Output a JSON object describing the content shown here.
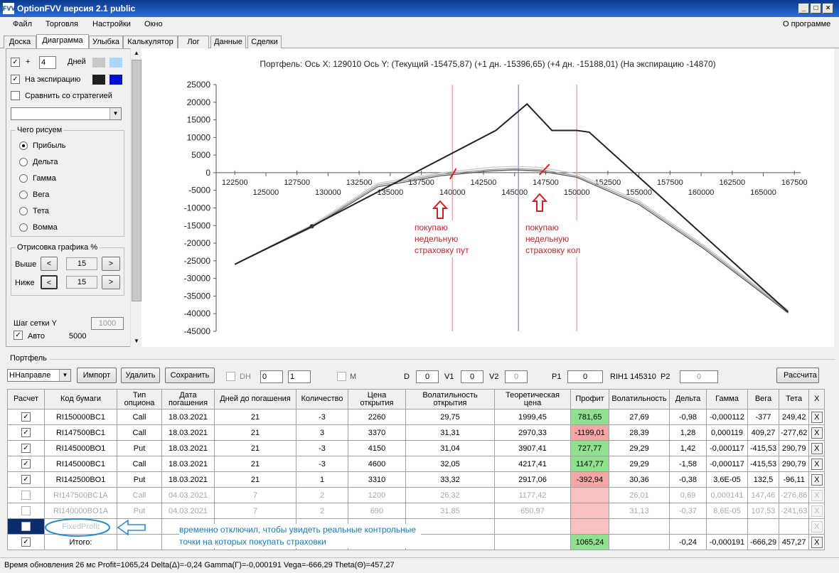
{
  "window": {
    "title": "OptionFVV версия 2.1 public",
    "icon": "FVV"
  },
  "menu": [
    "Файл",
    "Торговля",
    "Настройки",
    "Окно"
  ],
  "menu_right": "О программе",
  "tabs": [
    "Доска",
    "Диаграмма",
    "Улыбка",
    "Калькулятор",
    "Лог",
    "Данные",
    "Сделки"
  ],
  "left": {
    "plus_label": "+",
    "days_value": "4",
    "days_label": "Дней",
    "expiry_label": "На экспирацию",
    "compare_label": "Сравнить со стратегией",
    "draw_group": "Чего рисуем",
    "radios": [
      "Прибыль",
      "Дельта",
      "Гамма",
      "Вега",
      "Тета",
      "Вомма"
    ],
    "selected_radio": "Прибыль",
    "render_group": "Отрисовка графика %",
    "above_label": "Выше",
    "above_value": "15",
    "below_label": "Ниже",
    "below_value": "15",
    "grid_step_label": "Шаг сетки Y",
    "grid_step_value": "1000",
    "auto_label": "Авто",
    "auto_value": "5000",
    "btn_left": "<",
    "btn_right": ">",
    "swatch_colors": [
      "#c8c8c8",
      "#a8d8ff",
      "#202020",
      "#0010d0"
    ]
  },
  "chart_header": "Портфель: Ось X:  129010 Ось Y:   (Текущий -15475,87)   (+1 дн. -15396,65)   (+4 дн. -15188,01)   (На экспирацию -14870)",
  "chart_data": {
    "type": "line",
    "xlim": [
      121000,
      168000
    ],
    "ylim": [
      -45000,
      25000
    ],
    "y_ticks": [
      25000,
      20000,
      15000,
      10000,
      5000,
      0,
      -5000,
      -10000,
      -15000,
      -20000,
      -25000,
      -30000,
      -35000,
      -40000,
      -45000
    ],
    "x_ticks_upper": [
      122500,
      127500,
      132500,
      137500,
      142500,
      147500,
      152500,
      157500,
      162500,
      167500
    ],
    "x_ticks_lower": [
      125000,
      130000,
      135000,
      140000,
      145000,
      150000,
      155000,
      160000,
      165000
    ],
    "series": [
      {
        "color": "#222222",
        "x": [
          122500,
          128700,
          143500,
          146000,
          148000,
          150000,
          151000,
          167000
        ],
        "y": [
          -26000,
          -15200,
          12000,
          19500,
          12000,
          12000,
          11500,
          -39500
        ]
      },
      {
        "color": "#c8c8c8",
        "x": [
          122500,
          128700,
          134000,
          139000,
          143000,
          145000,
          147000,
          150000,
          155000,
          160000,
          167000
        ],
        "y": [
          -26000,
          -14800,
          -3000,
          -100,
          1500,
          1800,
          1500,
          -300,
          -8000,
          -20000,
          -39000
        ]
      },
      {
        "color": "#999999",
        "x": [
          122500,
          128700,
          134000,
          139000,
          143000,
          145000,
          147000,
          150000,
          155000,
          160000,
          167000
        ],
        "y": [
          -26000,
          -15200,
          -3500,
          -500,
          900,
          1200,
          900,
          -900,
          -8500,
          -20500,
          -39400
        ]
      },
      {
        "color": "#555555",
        "x": [
          122500,
          128700,
          134000,
          139000,
          143000,
          145000,
          147000,
          150000,
          155000,
          160000,
          167000
        ],
        "y": [
          -26000,
          -15500,
          -4000,
          -900,
          500,
          800,
          500,
          -1300,
          -9000,
          -21000,
          -39800
        ]
      }
    ],
    "vlines": [
      {
        "x": 145310,
        "color": "#8090c0"
      },
      {
        "x": 140000,
        "color": "#f0a0a0"
      },
      {
        "x": 150000,
        "color": "#f0a0a0"
      }
    ],
    "marker": {
      "x": 128700,
      "y": -15200
    }
  },
  "annotations": {
    "put": "покупаю недельную страховку пут",
    "call": "покупаю недельную страховку кол",
    "disabled": "временно отключил, чтобы увидеть реальные контрольные точки на которых покупать страховки"
  },
  "portfolio": {
    "label": "Портфель",
    "select_value": "ННаправле",
    "import_btn": "Импорт",
    "delete_btn": "Удалить",
    "save_btn": "Сохранить",
    "dh_label": "DH",
    "dh_v1": "0",
    "dh_v2": "1",
    "m_label": "M",
    "d_label": "D",
    "d_value": "0",
    "v1_label": "V1",
    "v1_value": "0",
    "v2_label": "V2",
    "v2_value": "0",
    "p1_label": "P1",
    "p1_value": "0",
    "rih_label": "RIH1 145310",
    "p2_label": "P2",
    "p2_value": "0",
    "calc_btn": "Рассчита",
    "columns": [
      "Расчет",
      "Код бумаги",
      "Тип опциона",
      "Дата погашения",
      "Дней до погашения",
      "Количество",
      "Цена открытия",
      "Волатильность открытия",
      "Теоретическая цена",
      "Профит",
      "Волатильность",
      "Дельта",
      "Гамма",
      "Вега",
      "Тета",
      "X"
    ],
    "rows": [
      {
        "chk": "✓",
        "code": "RI150000BC1",
        "type": "Call",
        "date": "18.03.2021",
        "days": "21",
        "qty": "-3",
        "price": "2260",
        "vol_open": "29,75",
        "theo": "1999,45",
        "profit": "781,65",
        "vol": "27,69",
        "delta": "-0,98",
        "gamma": "-0,000112",
        "vega": "-377",
        "theta": "249,42",
        "x": "X"
      },
      {
        "chk": "✓",
        "code": "RI147500BC1",
        "type": "Call",
        "date": "18.03.2021",
        "days": "21",
        "qty": "3",
        "price": "3370",
        "vol_open": "31,31",
        "theo": "2970,33",
        "profit": "-1199,01",
        "vol": "28,39",
        "delta": "1,28",
        "gamma": "0,000119",
        "vega": "409,27",
        "theta": "-277,62",
        "x": "X"
      },
      {
        "chk": "✓",
        "code": "RI145000BO1",
        "type": "Put",
        "date": "18.03.2021",
        "days": "21",
        "qty": "-3",
        "price": "4150",
        "vol_open": "31,04",
        "theo": "3907,41",
        "profit": "727,77",
        "vol": "29,29",
        "delta": "1,42",
        "gamma": "-0,000117",
        "vega": "-415,53",
        "theta": "290,79",
        "x": "X"
      },
      {
        "chk": "✓",
        "code": "RI145000BC1",
        "type": "Call",
        "date": "18.03.2021",
        "days": "21",
        "qty": "-3",
        "price": "4600",
        "vol_open": "32,05",
        "theo": "4217,41",
        "profit": "1147,77",
        "vol": "29,29",
        "delta": "-1,58",
        "gamma": "-0,000117",
        "vega": "-415,53",
        "theta": "290,79",
        "x": "X"
      },
      {
        "chk": "✓",
        "code": "RI142500BO1",
        "type": "Put",
        "date": "18.03.2021",
        "days": "21",
        "qty": "1",
        "price": "3310",
        "vol_open": "33,32",
        "theo": "2917,06",
        "profit": "-392,94",
        "vol": "30,36",
        "delta": "-0,38",
        "gamma": "3,6E-05",
        "vega": "132,5",
        "theta": "-96,11",
        "x": "X"
      },
      {
        "chk": "",
        "code": "RI147500BC1A",
        "type": "Call",
        "date": "04.03.2021",
        "days": "7",
        "qty": "2",
        "price": "1200",
        "vol_open": "26,32",
        "theo": "1177,42",
        "profit": "",
        "vol": "26,01",
        "delta": "0,69",
        "gamma": "0,000141",
        "vega": "147,46",
        "theta": "-276,86",
        "x": "X"
      },
      {
        "chk": "",
        "code": "RI140000BO1A",
        "type": "Put",
        "date": "04.03.2021",
        "days": "7",
        "qty": "2",
        "price": "690",
        "vol_open": "31,85",
        "theo": "650,97",
        "profit": "",
        "vol": "31,13",
        "delta": "-0,37",
        "gamma": "8,6E-05",
        "vega": "107,53",
        "theta": "-241,63",
        "x": "X"
      },
      {
        "chk": "",
        "code": "FixedProfit",
        "type": "",
        "date": "",
        "days": "",
        "qty": "",
        "price": "",
        "vol_open": "",
        "theo": "",
        "profit": "",
        "vol": "",
        "delta": "",
        "gamma": "",
        "vega": "",
        "theta": "",
        "x": "X"
      },
      {
        "chk": "✓",
        "code": "Итого:",
        "type": "",
        "date": "",
        "days": "",
        "qty": "",
        "price": "",
        "vol_open": "",
        "theo": "",
        "profit": "1065,24",
        "vol": "",
        "delta": "-0,24",
        "gamma": "-0,000191",
        "vega": "-666,29",
        "theta": "457,27",
        "x": "X"
      }
    ]
  },
  "status": "Время обновления 26 мс  Profit=1065,24 Delta(Δ)=-0,24 Gamma(Γ)=-0,000191 Vega=-666,29 Theta(Θ)=457,27"
}
